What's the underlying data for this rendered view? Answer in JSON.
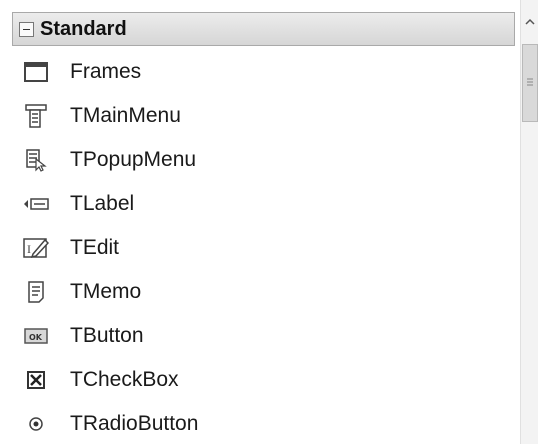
{
  "palette": {
    "category": {
      "title": "Standard",
      "icon": "collapse-minus-icon"
    },
    "items": [
      {
        "label": "Frames",
        "icon": "frame-icon"
      },
      {
        "label": "TMainMenu",
        "icon": "main-menu-icon"
      },
      {
        "label": "TPopupMenu",
        "icon": "popup-menu-icon"
      },
      {
        "label": "TLabel",
        "icon": "label-icon"
      },
      {
        "label": "TEdit",
        "icon": "edit-icon"
      },
      {
        "label": "TMemo",
        "icon": "memo-icon"
      },
      {
        "label": "TButton",
        "icon": "button-icon"
      },
      {
        "label": "TCheckBox",
        "icon": "checkbox-icon"
      },
      {
        "label": "TRadioButton",
        "icon": "radio-button-icon"
      }
    ]
  },
  "scrollbar": {
    "up_icon": "scroll-up-arrow-icon",
    "thumb_icon": "grip-icon"
  },
  "colors": {
    "header_bg": "#d6d6d6",
    "header_border": "#a9a9a9",
    "icon": "#444444"
  }
}
